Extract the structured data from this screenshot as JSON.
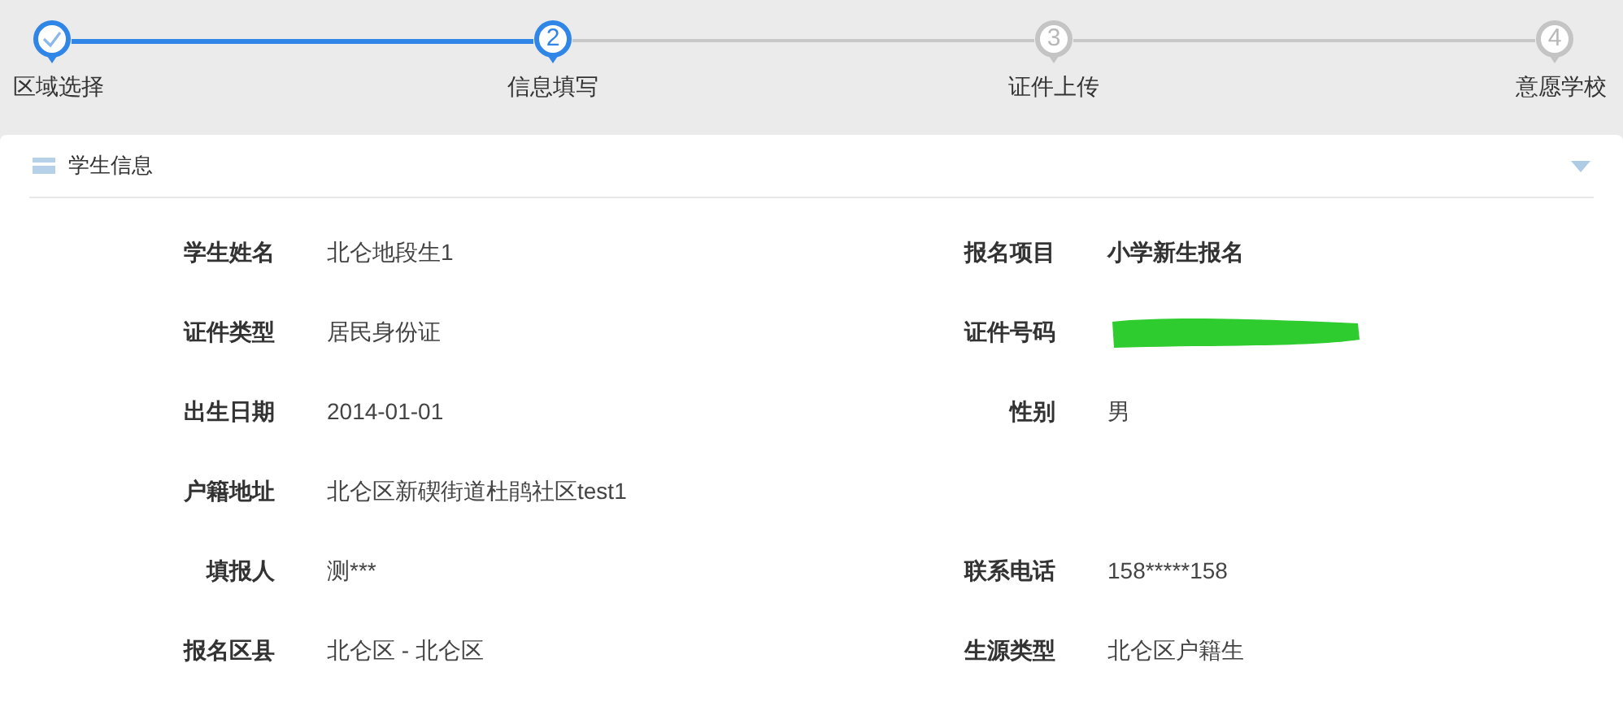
{
  "steps": [
    {
      "label": "区域选择",
      "completed": true,
      "selected": false
    },
    {
      "label": "信息填写",
      "completed": false,
      "selected": true,
      "number": "2"
    },
    {
      "label": "证件上传",
      "completed": false,
      "selected": false,
      "number": "3"
    },
    {
      "label": "意愿学校",
      "completed": false,
      "selected": false,
      "number": "4"
    }
  ],
  "panel": {
    "title": "学生信息",
    "expanded": true,
    "rows": [
      [
        {
          "label": "学生姓名",
          "value": "北仑地段生1",
          "kind": "text"
        },
        {
          "label": "报名项目",
          "value": "小学新生报名",
          "kind": "strong"
        }
      ],
      [
        {
          "label": "证件类型",
          "value": "居民身份证",
          "kind": "text"
        },
        {
          "label": "证件号码",
          "kind": "redacted"
        }
      ],
      [
        {
          "label": "出生日期",
          "value": "2014-01-01",
          "kind": "text"
        },
        {
          "label": "性别",
          "value": "男",
          "kind": "text"
        }
      ],
      [
        {
          "label": "户籍地址",
          "value": "北仑区新碶街道杜鹃社区test1",
          "kind": "text"
        }
      ],
      [
        {
          "label": "填报人",
          "value": "测***",
          "kind": "text"
        },
        {
          "label": "联系电话",
          "value": "158*****158",
          "kind": "text"
        }
      ],
      [
        {
          "label": "报名区县",
          "value": "北仑区 - 北仑区",
          "kind": "text"
        },
        {
          "label": "生源类型",
          "value": "北仑区户籍生",
          "kind": "text"
        }
      ]
    ]
  }
}
